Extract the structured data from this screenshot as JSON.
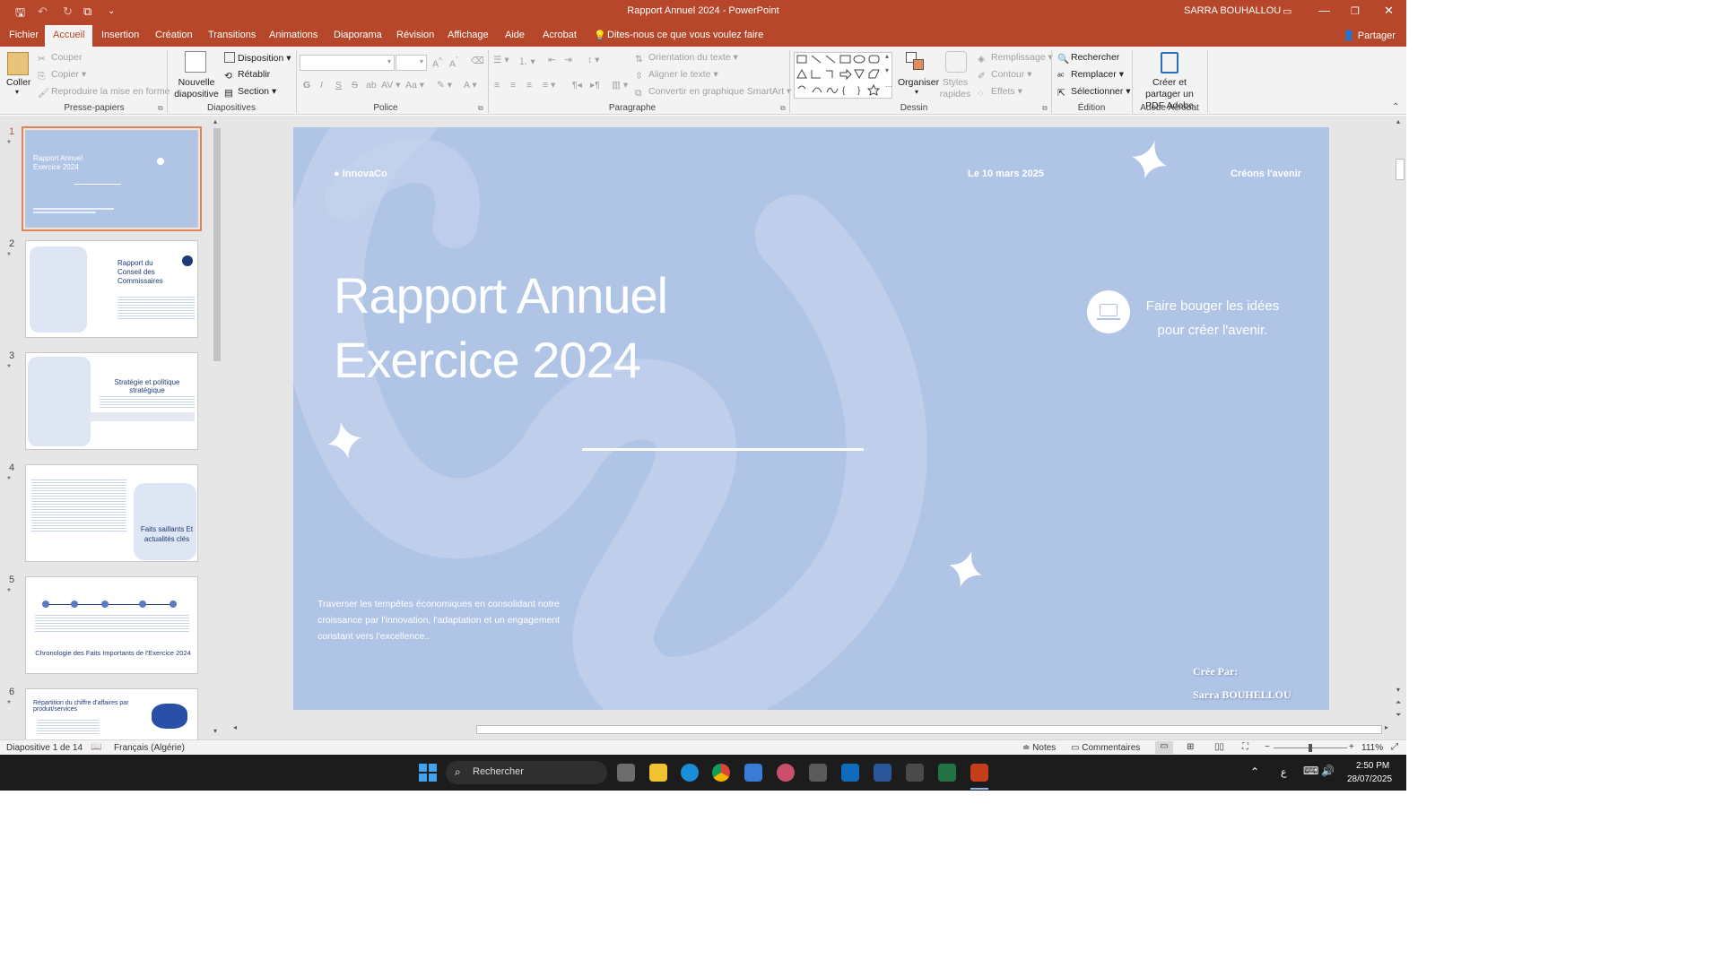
{
  "window": {
    "title": "Rapport Annuel 2024  -  PowerPoint",
    "user": "SARRA BOUHALLOU",
    "accent": "#b7472a"
  },
  "ribbon_tabs": [
    "Fichier",
    "Accueil",
    "Insertion",
    "Création",
    "Transitions",
    "Animations",
    "Diaporama",
    "Révision",
    "Affichage",
    "Aide",
    "Acrobat"
  ],
  "tell_me": "Dites-nous ce que vous voulez faire",
  "share": "Partager",
  "clipboard": {
    "paste": "Coller",
    "cut": "Couper",
    "copy": "Copier",
    "format_painter": "Reproduire la mise en forme",
    "group": "Presse-papiers"
  },
  "slides_group": {
    "new_slide": "Nouvelle diapositive",
    "layout": "Disposition",
    "reset": "Rétablir",
    "section": "Section",
    "group": "Diapositives"
  },
  "font_group": {
    "group": "Police"
  },
  "paragraph_group": {
    "text_direction": "Orientation du texte",
    "align_text": "Aligner le texte",
    "smartart": "Convertir en graphique SmartArt",
    "group": "Paragraphe"
  },
  "drawing_group": {
    "arrange": "Organiser",
    "quick_styles": "Styles rapides",
    "fill": "Remplissage",
    "outline": "Contour",
    "effects": "Effets",
    "group": "Dessin"
  },
  "editing_group": {
    "find": "Rechercher",
    "replace": "Remplacer",
    "select": "Sélectionner",
    "group": "Édition"
  },
  "acrobat_group": {
    "create_share": "Créer et partager un PDF Adobe",
    "group": "Adobe Acrobat"
  },
  "thumbnails": [
    {
      "num": "1",
      "title": "Rapport Annuel Exercice 2024"
    },
    {
      "num": "2",
      "title": "Rapport du Conseil des Commissaires"
    },
    {
      "num": "3",
      "title": "Stratégie et politique stratégique"
    },
    {
      "num": "4",
      "title": "Faits saillants Et actualités clés"
    },
    {
      "num": "5",
      "title": "Chronologie des Faits Importants de l'Exercice 2024"
    },
    {
      "num": "6",
      "title": "Répartition du chiffre d'affaires par produit/services"
    }
  ],
  "slide": {
    "company": "● InnovaCo",
    "date": "Le 10 mars 2025",
    "tagline": "Créons l'avenir",
    "title_line1": "Rapport Annuel",
    "title_line2": "Exercice 2024",
    "callout_line1": "Faire bouger les idées",
    "callout_line2": "pour créer l'avenir.",
    "body": "Traverser les tempêtes économiques en consolidant notre croissance par l'innovation, l'adaptation et un engagement constant vers l'excellence..",
    "author_label": "Crée Par:",
    "author_name": "Sarra BOUHELLOU",
    "bg": "#b0c4e6"
  },
  "status": {
    "slide_index": "Diapositive 1 de 14",
    "language": "Français (Algérie)",
    "notes": "Notes",
    "comments": "Commentaires",
    "zoom": "111%"
  },
  "taskbar": {
    "search": "Rechercher",
    "lang": "ع",
    "time": "2:50 PM",
    "date": "28/07/2025"
  }
}
